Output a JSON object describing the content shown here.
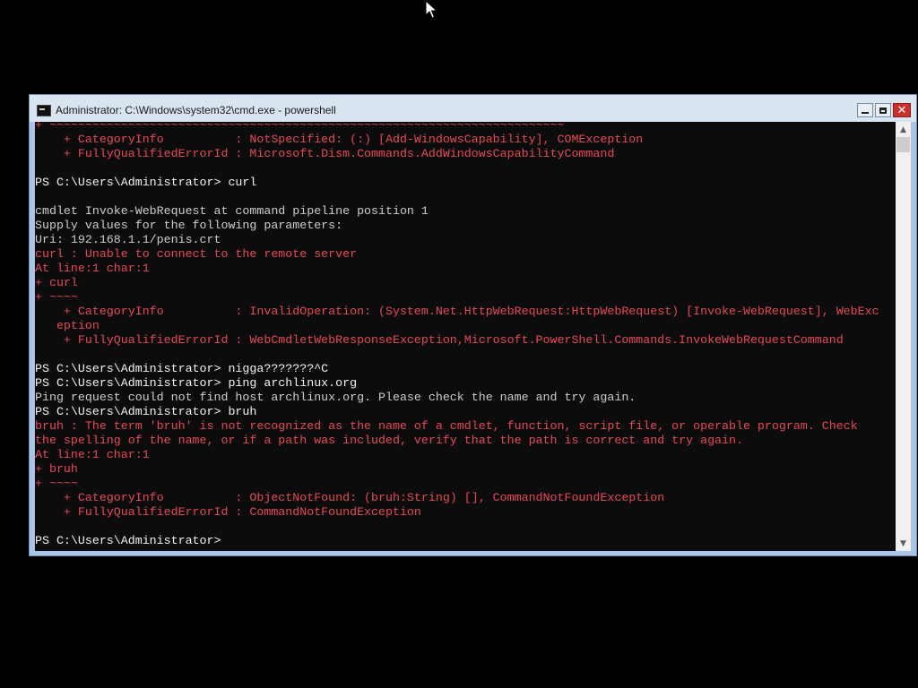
{
  "window": {
    "title": "Administrator: C:\\Windows\\system32\\cmd.exe - powershell"
  },
  "icons": {
    "app": "console-icon",
    "minimize": "minimize-icon",
    "maximize": "maximize-icon",
    "close": "close-icon",
    "close_glyph": "✕",
    "scroll_up": "▲",
    "scroll_down": "▼"
  },
  "colors": {
    "console_bg": "#0c0c0c",
    "text": "#cccccc",
    "error": "#e74856",
    "titlebar": "#d9e4f1",
    "close_button": "#c9302c"
  },
  "console": {
    "lines": [
      {
        "text": "+ ~~~~~~~~~~~~~~~~~~~~~~~~~~~~~~~~~~~~~~~~~~~~~~~~~~~~~~~~~~~~~~~~~~~~~~~~",
        "type": "err"
      },
      {
        "text": "    + CategoryInfo          : NotSpecified: (:) [Add-WindowsCapability], COMException",
        "type": "err"
      },
      {
        "text": "    + FullyQualifiedErrorId : Microsoft.Dism.Commands.AddWindowsCapabilityCommand",
        "type": "err"
      },
      {
        "text": "",
        "type": "out"
      },
      {
        "text": "PS C:\\Users\\Administrator> curl",
        "type": "cmd"
      },
      {
        "text": "",
        "type": "out"
      },
      {
        "text": "cmdlet Invoke-WebRequest at command pipeline position 1",
        "type": "out"
      },
      {
        "text": "Supply values for the following parameters:",
        "type": "out"
      },
      {
        "text": "Uri: 192.168.1.1/penis.crt",
        "type": "out"
      },
      {
        "text": "curl : Unable to connect to the remote server",
        "type": "err"
      },
      {
        "text": "At line:1 char:1",
        "type": "err"
      },
      {
        "text": "+ curl",
        "type": "err"
      },
      {
        "text": "+ ~~~~",
        "type": "err"
      },
      {
        "text": "    + CategoryInfo          : InvalidOperation: (System.Net.HttpWebRequest:HttpWebRequest) [Invoke-WebRequest], WebExc",
        "type": "err"
      },
      {
        "text": "   eption",
        "type": "err"
      },
      {
        "text": "    + FullyQualifiedErrorId : WebCmdletWebResponseException,Microsoft.PowerShell.Commands.InvokeWebRequestCommand",
        "type": "err"
      },
      {
        "text": "",
        "type": "out"
      },
      {
        "text": "PS C:\\Users\\Administrator> nigga???????^C",
        "type": "cmd"
      },
      {
        "text": "PS C:\\Users\\Administrator> ping archlinux.org",
        "type": "cmd"
      },
      {
        "text": "Ping request could not find host archlinux.org. Please check the name and try again.",
        "type": "out"
      },
      {
        "text": "PS C:\\Users\\Administrator> bruh",
        "type": "cmd"
      },
      {
        "text": "bruh : The term 'bruh' is not recognized as the name of a cmdlet, function, script file, or operable program. Check",
        "type": "err"
      },
      {
        "text": "the spelling of the name, or if a path was included, verify that the path is correct and try again.",
        "type": "err"
      },
      {
        "text": "At line:1 char:1",
        "type": "err"
      },
      {
        "text": "+ bruh",
        "type": "err"
      },
      {
        "text": "+ ~~~~",
        "type": "err"
      },
      {
        "text": "    + CategoryInfo          : ObjectNotFound: (bruh:String) [], CommandNotFoundException",
        "type": "err"
      },
      {
        "text": "    + FullyQualifiedErrorId : CommandNotFoundException",
        "type": "err"
      },
      {
        "text": "",
        "type": "out"
      },
      {
        "text": "PS C:\\Users\\Administrator>",
        "type": "cmd"
      }
    ]
  }
}
